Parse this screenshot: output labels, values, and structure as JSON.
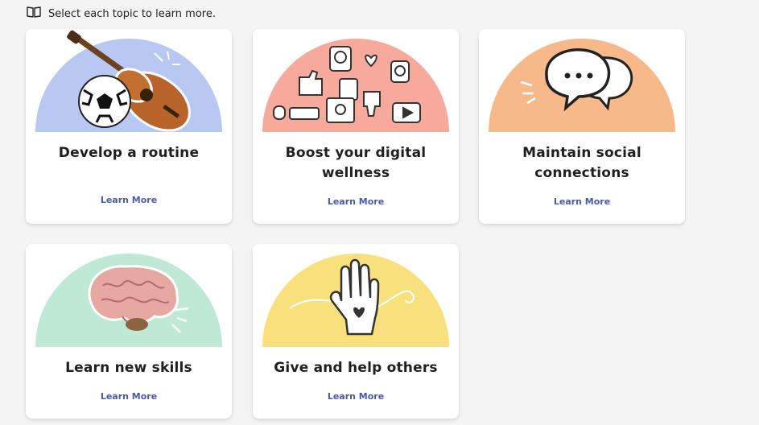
{
  "header": {
    "icon": "open-book-icon",
    "text": "Select each topic to learn more."
  },
  "cards": [
    {
      "title_lines": [
        "Develop a routine"
      ],
      "learn_more": "Learn More",
      "art_color": "#b9c8f2",
      "art_icons": [
        "soccer-ball-icon",
        "ukulele-icon"
      ]
    },
    {
      "title_lines": [
        "Boost your digital",
        "wellness"
      ],
      "learn_more": "Learn More",
      "art_color": "#f7a99c",
      "art_icons": [
        "social-media-stickers-icon"
      ]
    },
    {
      "title_lines": [
        "Maintain social",
        "connections"
      ],
      "learn_more": "Learn More",
      "art_color": "#f7b88a",
      "art_icons": [
        "chat-bubbles-icon"
      ]
    },
    {
      "title_lines": [
        "Learn new skills"
      ],
      "learn_more": "Learn More",
      "art_color": "#bfe9d4",
      "art_icons": [
        "brain-icon"
      ]
    },
    {
      "title_lines": [
        "Give and help others"
      ],
      "learn_more": "Learn More",
      "art_color": "#f8e07c",
      "art_icons": [
        "helping-hand-heart-icon"
      ]
    }
  ]
}
